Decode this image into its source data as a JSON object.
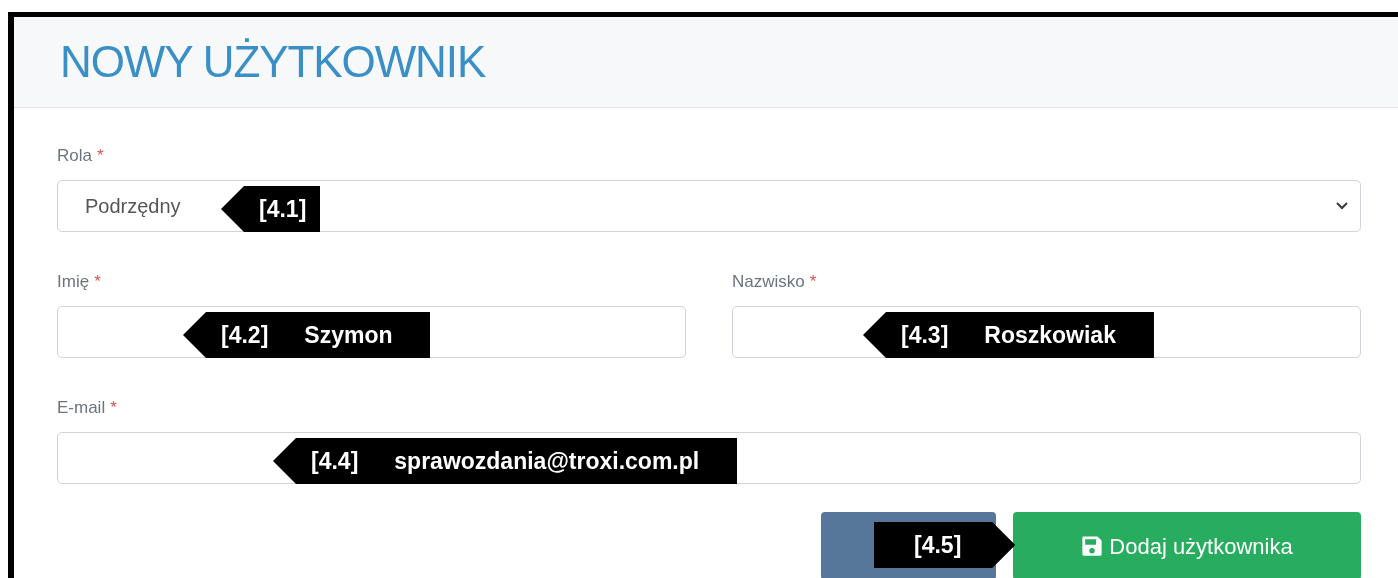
{
  "title": "NOWY UŻYTKOWNIK",
  "fields": [
    {
      "kind": "select",
      "label": "Rola",
      "marker": "*",
      "value": "Podrzędny",
      "callout": {
        "number": "[4.1]"
      }
    },
    {
      "kind": "text",
      "label": "Imię",
      "marker": "*",
      "callout": {
        "number": "[4.2]",
        "text": "Szymon"
      }
    },
    {
      "kind": "text",
      "label": "Nazwisko",
      "marker": "*",
      "callout": {
        "number": "[4.3]",
        "text": "Roszkowiak"
      }
    },
    {
      "kind": "text",
      "label": "E-mail",
      "marker": "*",
      "callout": {
        "number": "[4.4]",
        "text": "sprawozdania@troxi.com.pl"
      }
    }
  ],
  "buttons": [
    {
      "kind": "plain",
      "callout": {
        "number": "[4.5]"
      }
    },
    {
      "kind": "save",
      "label": "Dodaj użytkownika"
    }
  ]
}
